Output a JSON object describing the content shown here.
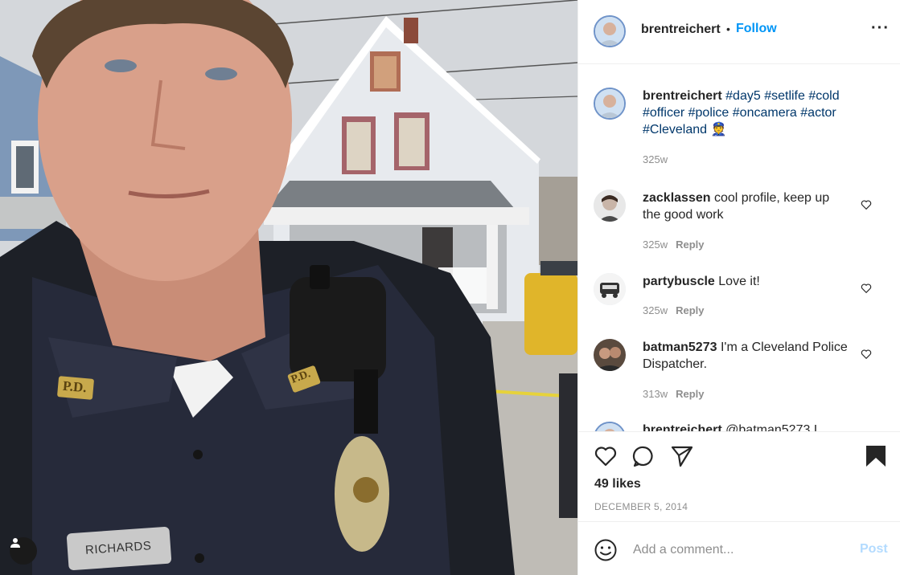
{
  "post": {
    "username": "brentreichert",
    "separator": "•",
    "follow_label": "Follow",
    "more_label": "···",
    "image_alt": "Selfie of an actor in police uniform in front of a house",
    "badge_nameplate": "RICHARDS",
    "collar_pin_left": "P.D.",
    "collar_pin_right": "P.D."
  },
  "caption": {
    "username": "brentreichert",
    "text": "#day5 #setlife #cold #officer #police #oncamera #actor #Cleveland 👮",
    "time": "325w"
  },
  "comments": [
    {
      "username": "zacklassen",
      "text": "cool profile, keep up the good work",
      "time": "325w",
      "reply_label": "Reply"
    },
    {
      "username": "partybuscle",
      "text": "Love it!",
      "time": "325w",
      "reply_label": "Reply"
    },
    {
      "username": "batman5273",
      "text": "I'm a Cleveland Police Dispatcher.",
      "time": "313w",
      "reply_label": "Reply"
    },
    {
      "username": "brentreichert",
      "text": "@batman5273 I...",
      "time": "",
      "reply_label": ""
    }
  ],
  "actions": {
    "likes": "49 likes",
    "date": "DECEMBER 5, 2014"
  },
  "add_comment": {
    "placeholder": "Add a comment...",
    "post_label": "Post"
  },
  "colors": {
    "link_blue": "#0095f6",
    "hashtag": "#00376b",
    "muted": "#8e8e8e",
    "post_disabled": "#b3dbff"
  }
}
